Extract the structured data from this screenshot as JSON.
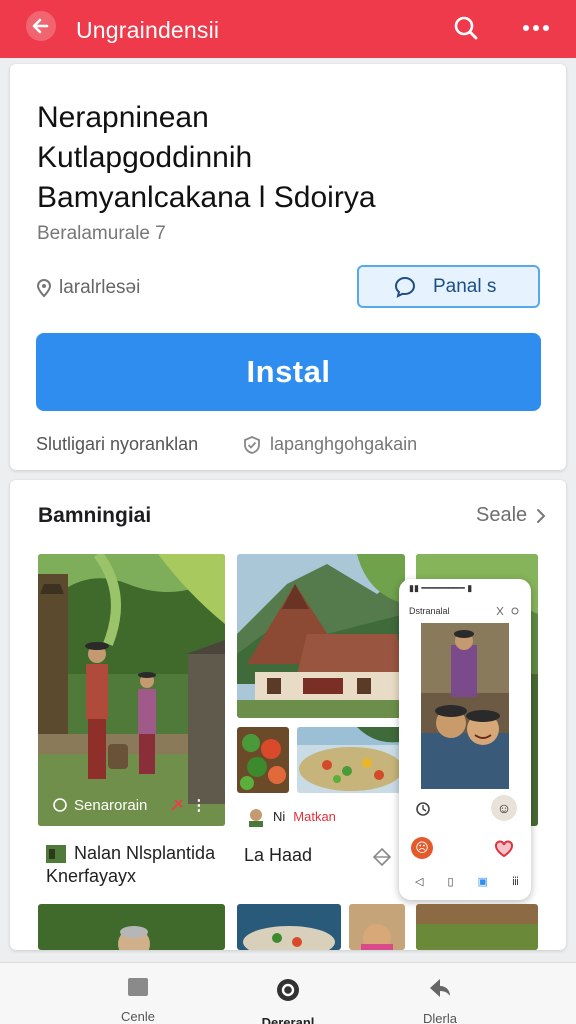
{
  "appbar": {
    "title": "Ungraindensii",
    "icons": [
      "back-arrow-icon",
      "search-icon",
      "more-dots-icon"
    ],
    "color": "#ee3a4a"
  },
  "app": {
    "headline_lines": [
      "Nerapninean",
      "Kutlapgoddinnih",
      "Bamyanlcakana l Sdoirya"
    ],
    "subtitle": "Beralamurale 7",
    "location": "laralrlesəi",
    "pill_label": "Panal s",
    "install_label": "Instal",
    "meta_left": "Slutligari nyoranklan",
    "meta_right": "lapanghgohgakain",
    "accent": "#2f8def"
  },
  "gallery": {
    "title": "Bamningiai",
    "see_all": "Seale",
    "tile1_caption": "Senarorain",
    "tile2_tag_a": "Ni",
    "tile2_tag_b": "Matkan",
    "label1_line1": "Nalan Nlsplantida",
    "label1_line2": "Knerfayayx",
    "label2": "La Haad",
    "phone_title": "Dstranalal"
  },
  "bottom_nav": {
    "items": [
      "Cenle",
      "Dereranl",
      "Dlerla"
    ],
    "icons": [
      "square-icon",
      "record-icon",
      "back-arrow-icon"
    ]
  }
}
